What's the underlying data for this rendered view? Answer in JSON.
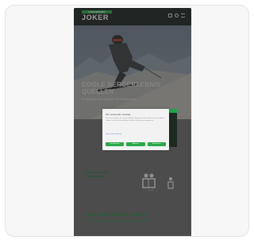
{
  "header": {
    "logo_top": "STEIERMARK",
    "logo_main": "JOKER"
  },
  "icons": [
    "cart-icon",
    "user-icon",
    "menu-icon"
  ],
  "hero": {
    "title": "COOLE BERG­ERLEBNIS QUELLEN",
    "subtitle": "20 Skitage und Rabatte für Steiermark"
  },
  "cookie_modal": {
    "title": "Wir verwenden Cookies",
    "text": "Wir nutzen Cookies auf unserer Website. Einige von ihnen sind essenziell, während andere uns helfen, diese Website und Ihre Erfahrung zu verbessern.",
    "links": "Datenschutzerklärung",
    "buttons": [
      "Einstellungen",
      "Ablehnen",
      "Akzeptieren"
    ]
  },
  "promo": {
    "left_text": "Steiermark Joker Erlebnisvorteile",
    "figure_label": "Familie"
  },
  "bottom": {
    "title": "DEIN STEIERMARK JOKER",
    "subtitle": "Ab 80 Euro sparen und Vorteile nutzen beim Wandern"
  },
  "colors": {
    "brand_green": "#2aa84a",
    "topbar": "#1d2320"
  }
}
